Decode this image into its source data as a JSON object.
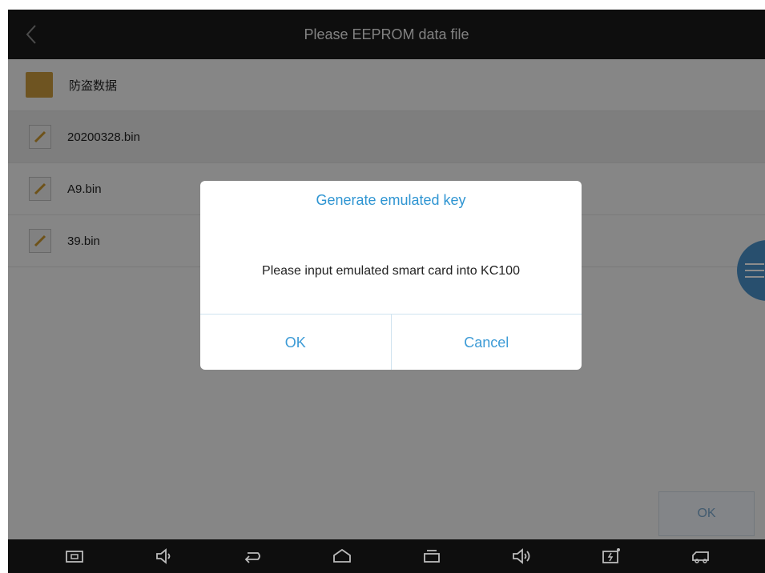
{
  "header": {
    "title": "Please EEPROM data file",
    "back_icon": "chevron-left-icon"
  },
  "files": [
    {
      "name": "防盗数据",
      "type": "folder",
      "icon": "folder-icon"
    },
    {
      "name": "20200328.bin",
      "type": "file",
      "icon": "edit-file-icon",
      "selected": true
    },
    {
      "name": "A9.bin",
      "type": "file",
      "icon": "edit-file-icon"
    },
    {
      "name": "39.bin",
      "type": "file",
      "icon": "edit-file-icon"
    }
  ],
  "footer": {
    "ok_label": "OK"
  },
  "dialog": {
    "title": "Generate emulated key",
    "message": "Please input emulated smart card into KC100",
    "ok_label": "OK",
    "cancel_label": "Cancel"
  },
  "colors": {
    "accent": "#2f95d2",
    "folder": "#c99a3c",
    "floating_button": "#4a90c8"
  },
  "navbar": {
    "icons": [
      "screenshot-icon",
      "volume-down-icon",
      "back-icon",
      "home-icon",
      "recent-apps-icon",
      "volume-up-icon",
      "battery-icon",
      "car-icon"
    ]
  }
}
